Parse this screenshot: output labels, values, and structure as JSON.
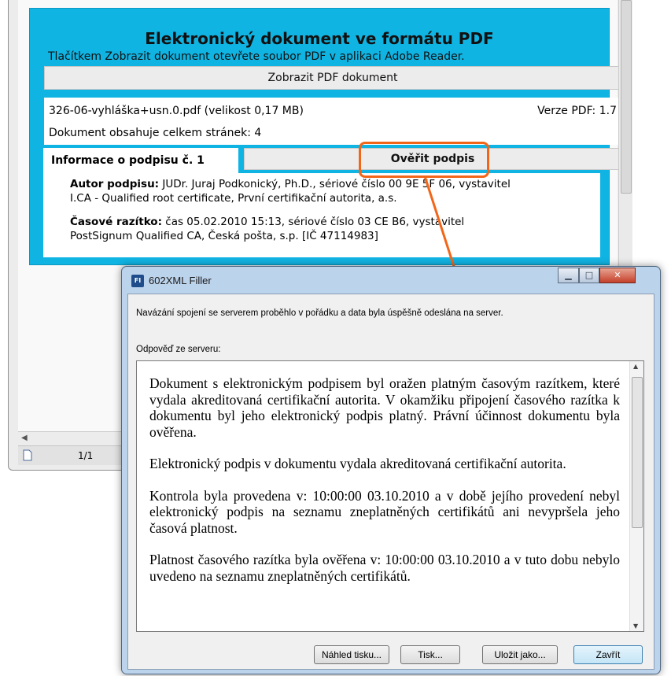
{
  "document_panel": {
    "title": "Elektronický dokument ve formátu PDF",
    "subtitle": "Tlačítkem Zobrazit dokument otevřete soubor PDF v aplikaci Adobe Reader.",
    "show_pdf_button": "Zobrazit PDF dokument",
    "file_info": "326-06-vyhláška+usn.0.pdf (velikost 0,17 MB)",
    "pdf_version": "Verze PDF: 1.7",
    "page_count": "Dokument obsahuje celkem stránek: 4",
    "signature_tab": "Informace o podpisu č. 1",
    "verify_button": "Ověřit podpis",
    "author_label": "Autor podpisu:",
    "author_text": "JUDr. Juraj Podkonický, Ph.D., sériové číslo 00 9E 5F 06, vystavitel",
    "author_text_2": "I.CA - Qualified root certificate, První certifikační autorita, a.s.",
    "timestamp_label": "Časové razítko:",
    "timestamp_text": "čas 05.02.2010 15:13, sériové číslo 03 CE B6, vystavitel",
    "timestamp_text_2": "PostSignum Qualified CA, Česká pošta, s.p. [IČ 47114983]"
  },
  "status_bar": {
    "page": "1/1"
  },
  "dialog": {
    "title": "602XML Filler",
    "message": "Navázání spojení se serverem proběhlo v pořádku a data byla úspěšně odeslána na server.",
    "reply_label": "Odpověď ze serveru:",
    "reply_paragraphs": [
      "Dokument s elektronickým podpisem byl oražen platným časovým razítkem, které vydala akreditovaná certifikační autorita. V okamžiku připojení časového razítka k dokumentu byl jeho elektronický podpis platný. Právní účinnost dokumentu byla ověřena.",
      "Elektronický podpis v dokumentu vydala akreditovaná certifikační autorita.",
      "Kontrola byla provedena v: 10:00:00 03.10.2010 a v době jejího provedení nebyl elektronický podpis na seznamu zneplatněných certifikátů ani nevypršela jeho časová platnost.",
      "Platnost časového razítka byla ověřena v: 10:00:00 03.10.2010 a v tuto dobu nebylo uvedeno na seznamu zneplatněných certifikátů."
    ],
    "buttons": {
      "preview": "Náhled tisku...",
      "print": "Tisk...",
      "save_as": "Uložit jako...",
      "close": "Zavřít"
    },
    "icon_label": "FI"
  },
  "colors": {
    "panel": "#10b4e3",
    "highlight": "#f2661a"
  }
}
